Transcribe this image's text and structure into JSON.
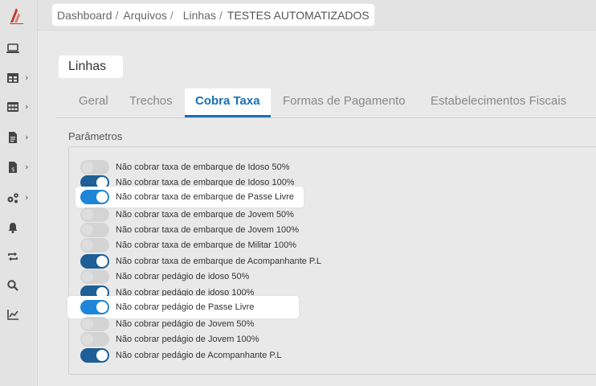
{
  "breadcrumb": {
    "items": [
      "Dashboard",
      "Arquivos",
      "Linhas",
      "TESTES AUTOMATIZADOS"
    ]
  },
  "page": {
    "title": "Linhas"
  },
  "tabs": [
    {
      "label": "Geral",
      "active": false
    },
    {
      "label": "Trechos",
      "active": false
    },
    {
      "label": "Cobra Taxa",
      "active": true
    },
    {
      "label": "Formas de Pagamento",
      "active": false
    },
    {
      "label": "Estabelecimentos Fiscais",
      "active": false
    }
  ],
  "section": {
    "label": "Parâmetros"
  },
  "parameters": [
    {
      "label": "Não cobrar taxa de embarque de Idoso 50%",
      "enabled": false
    },
    {
      "label": "Não cobrar taxa de embarque de Idoso 100%",
      "enabled": true
    },
    {
      "label": "Não cobrar taxa de embarque de Passe Livre",
      "enabled": true
    },
    {
      "label": "Não cobrar taxa de embarque de Jovem 50%",
      "enabled": false
    },
    {
      "label": "Não cobrar taxa de embarque de Jovem 100%",
      "enabled": false
    },
    {
      "label": "Não cobrar taxa de embarque de Militar 100%",
      "enabled": false
    },
    {
      "label": "Não cobrar taxa de embarque de Acompanhante P.L",
      "enabled": true
    },
    {
      "label": "Não cobrar pedágio de idoso 50%",
      "enabled": false
    },
    {
      "label": "Não cobrar pedágio de idoso 100%",
      "enabled": true
    },
    {
      "label": "Não cobrar pedágio de Passe Livre",
      "enabled": true
    },
    {
      "label": "Não cobrar pedágio de Jovem 50%",
      "enabled": false
    },
    {
      "label": "Não cobrar pedágio de Jovem 100%",
      "enabled": false
    },
    {
      "label": "Não cobrar pedágio de Acompanhante P.L",
      "enabled": true
    }
  ],
  "sidebar": {
    "items": [
      {
        "icon": "laptop-icon",
        "has_submenu": false
      },
      {
        "icon": "table-icon",
        "has_submenu": true
      },
      {
        "icon": "grid-icon",
        "has_submenu": true
      },
      {
        "icon": "document-icon",
        "has_submenu": true
      },
      {
        "icon": "invoice-icon",
        "has_submenu": true
      },
      {
        "icon": "gears-icon",
        "has_submenu": true
      },
      {
        "icon": "bell-icon",
        "has_submenu": false
      },
      {
        "icon": "sync-icon",
        "has_submenu": false
      },
      {
        "icon": "search-icon",
        "has_submenu": false
      },
      {
        "icon": "chart-icon",
        "has_submenu": false
      }
    ]
  },
  "colors": {
    "accent": "#1a6fb8",
    "toggle_on": "#1d5f96",
    "toggle_on_highlight": "#1e86d8",
    "logo": "#c0392b"
  }
}
